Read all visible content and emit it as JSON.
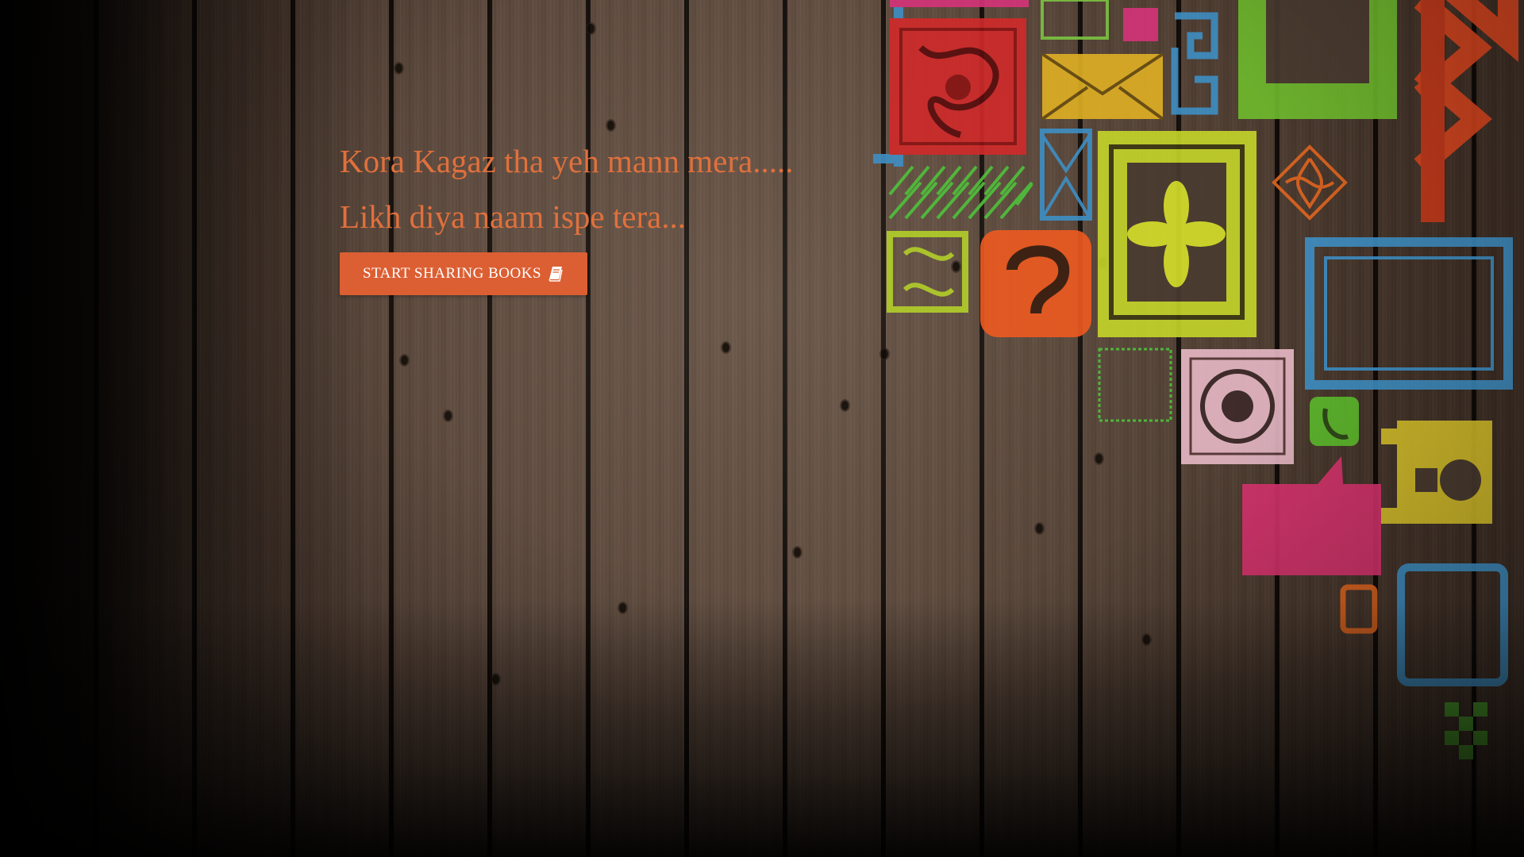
{
  "hero": {
    "line1": "Kora Kagaz tha yeh mann mera.....",
    "line2": "Likh diya naam ispe tera...",
    "cta_label": "START SHARING BOOKS",
    "cta_icon": "book-icon"
  },
  "colors": {
    "accent": "#dc5f33",
    "text_accent": "#e0703c",
    "button_text": "#ffffff",
    "wood": "#5a463a"
  }
}
